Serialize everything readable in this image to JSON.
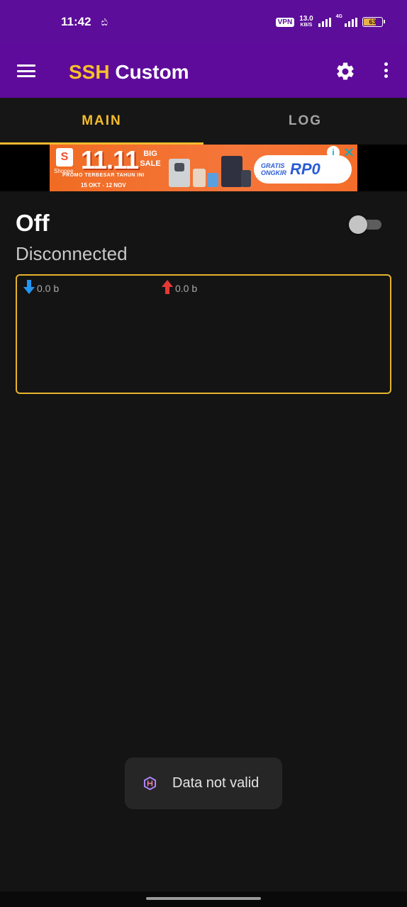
{
  "status_bar": {
    "time": "11:42",
    "notification_glyph": "ඪ",
    "vpn_label": "VPN",
    "net_speed_value": "13.0",
    "net_speed_unit": "KB/S",
    "network_type": "4G",
    "battery_level": "63",
    "battery_fraction": 0.63,
    "battery_color": "#e6b34a"
  },
  "app_bar": {
    "title_part1": "SSH",
    "title_part2": " Custom",
    "title_accent_color": "#f7c02a",
    "background_color": "#5e0b9b",
    "menu_icon": "hamburger-menu-icon",
    "settings_icon": "gear-icon",
    "overflow_icon": "more-vert-icon"
  },
  "tabs": [
    {
      "label": "MAIN",
      "active": true
    },
    {
      "label": "LOG",
      "active": false
    }
  ],
  "ad": {
    "brand": "Shopee",
    "brand_glyph": "S",
    "headline": "11.11",
    "headline_badge": "BIG SALE",
    "promo_text": "PROMO TERBESAR TAHUN INI",
    "date_range": "15 OKT - 12 NOV",
    "free_shipping_line1": "GRATIS",
    "free_shipping_line2": "ONGKIR",
    "free_shipping_amount": "RP0",
    "info_glyph": "i",
    "close_glyph": "✕"
  },
  "connection": {
    "state": "Off",
    "status": "Disconnected",
    "switch_on": false
  },
  "traffic": {
    "download_value": "0.0 b",
    "upload_value": "0.0 b",
    "download_icon": "download-arrow-icon",
    "upload_icon": "upload-arrow-icon",
    "download_color": "#2196f3",
    "upload_color": "#e53935"
  },
  "toast": {
    "message": "Data not valid",
    "icon": "app-logo-icon"
  }
}
